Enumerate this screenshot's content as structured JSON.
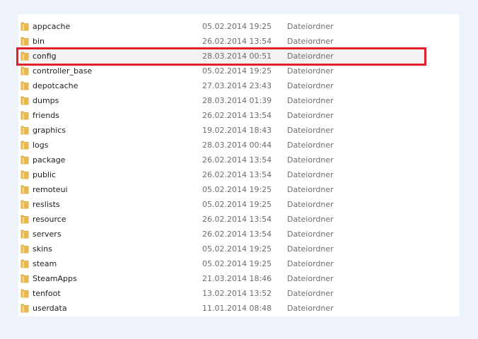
{
  "accent": {
    "highlight_color": "#e2202b",
    "folder_color": "#e8b84a"
  },
  "files": [
    {
      "name": "appcache",
      "date": "05.02.2014 19:25",
      "type": "Dateiordner",
      "icon": "folder-icon"
    },
    {
      "name": "bin",
      "date": "26.02.2014 13:54",
      "type": "Dateiordner",
      "icon": "folder-icon"
    },
    {
      "name": "config",
      "date": "28.03.2014 00:51",
      "type": "Dateiordner",
      "icon": "folder-icon",
      "selected": true
    },
    {
      "name": "controller_base",
      "date": "05.02.2014 19:25",
      "type": "Dateiordner",
      "icon": "folder-icon"
    },
    {
      "name": "depotcache",
      "date": "27.03.2014 23:43",
      "type": "Dateiordner",
      "icon": "folder-icon"
    },
    {
      "name": "dumps",
      "date": "28.03.2014 01:39",
      "type": "Dateiordner",
      "icon": "folder-icon"
    },
    {
      "name": "friends",
      "date": "26.02.2014 13:54",
      "type": "Dateiordner",
      "icon": "folder-icon"
    },
    {
      "name": "graphics",
      "date": "19.02.2014 18:43",
      "type": "Dateiordner",
      "icon": "folder-icon"
    },
    {
      "name": "logs",
      "date": "28.03.2014 00:44",
      "type": "Dateiordner",
      "icon": "folder-icon"
    },
    {
      "name": "package",
      "date": "26.02.2014 13:54",
      "type": "Dateiordner",
      "icon": "folder-icon"
    },
    {
      "name": "public",
      "date": "26.02.2014 13:54",
      "type": "Dateiordner",
      "icon": "folder-icon"
    },
    {
      "name": "remoteui",
      "date": "05.02.2014 19:25",
      "type": "Dateiordner",
      "icon": "folder-icon"
    },
    {
      "name": "reslists",
      "date": "05.02.2014 19:25",
      "type": "Dateiordner",
      "icon": "folder-icon"
    },
    {
      "name": "resource",
      "date": "26.02.2014 13:54",
      "type": "Dateiordner",
      "icon": "folder-icon"
    },
    {
      "name": "servers",
      "date": "26.02.2014 13:54",
      "type": "Dateiordner",
      "icon": "folder-icon"
    },
    {
      "name": "skins",
      "date": "05.02.2014 19:25",
      "type": "Dateiordner",
      "icon": "folder-icon"
    },
    {
      "name": "steam",
      "date": "05.02.2014 19:25",
      "type": "Dateiordner",
      "icon": "folder-icon"
    },
    {
      "name": "SteamApps",
      "date": "21.03.2014 18:46",
      "type": "Dateiordner",
      "icon": "folder-icon"
    },
    {
      "name": "tenfoot",
      "date": "13.02.2014 13:52",
      "type": "Dateiordner",
      "icon": "folder-icon"
    },
    {
      "name": "userdata",
      "date": "11.01.2014 08:48",
      "type": "Dateiordner",
      "icon": "folder-icon"
    }
  ]
}
